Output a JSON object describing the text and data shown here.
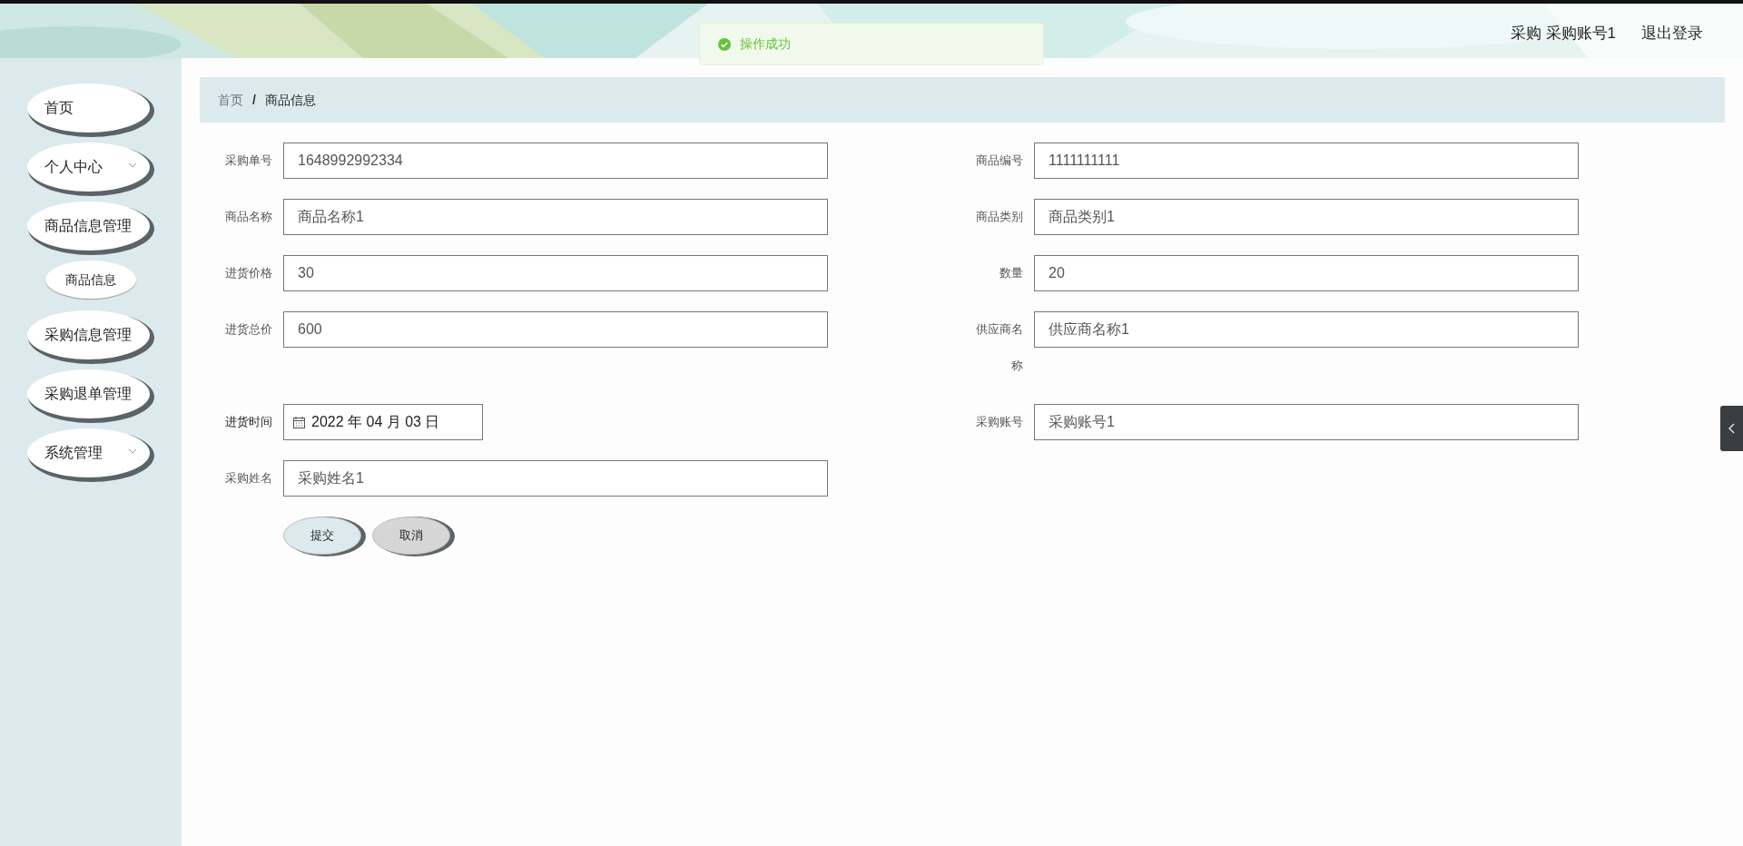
{
  "header": {
    "user_role": "采购",
    "user_name": "采购账号1",
    "logout": "退出登录"
  },
  "toast": {
    "message": "操作成功"
  },
  "sidebar": {
    "items": [
      {
        "label": "首页",
        "kind": "link"
      },
      {
        "label": "个人中心",
        "kind": "menu"
      },
      {
        "label": "商品信息管理",
        "kind": "link",
        "children": [
          {
            "label": "商品信息"
          }
        ]
      },
      {
        "label": "采购信息管理",
        "kind": "link"
      },
      {
        "label": "采购退单管理",
        "kind": "link"
      },
      {
        "label": "系统管理",
        "kind": "menu"
      }
    ]
  },
  "breadcrumb": {
    "separator": "/",
    "items": [
      "首页",
      "商品信息"
    ]
  },
  "form": {
    "fields": [
      {
        "label": "采购单号",
        "value": "1648992992334",
        "kind": "text"
      },
      {
        "label": "商品编号",
        "value": "1111111111",
        "kind": "text"
      },
      {
        "label": "商品名称",
        "value": "商品名称1",
        "kind": "text"
      },
      {
        "label": "商品类别",
        "value": "商品类别1",
        "kind": "text"
      },
      {
        "label": "进货价格",
        "value": "30",
        "kind": "text"
      },
      {
        "label": "数量",
        "value": "20",
        "kind": "text"
      },
      {
        "label": "进货总价",
        "value": "600",
        "kind": "text"
      },
      {
        "label": "供应商名称",
        "value": "供应商名称1",
        "kind": "text"
      },
      {
        "label": "进货时间",
        "value": "2022 年 04 月 03 日",
        "kind": "date"
      },
      {
        "label": "采购账号",
        "value": "采购账号1",
        "kind": "text"
      },
      {
        "label": "采购姓名",
        "value": "采购姓名1",
        "kind": "text"
      }
    ],
    "buttons": [
      {
        "label": "提交",
        "kind": "primary"
      },
      {
        "label": "取消",
        "kind": "secondary"
      }
    ]
  }
}
